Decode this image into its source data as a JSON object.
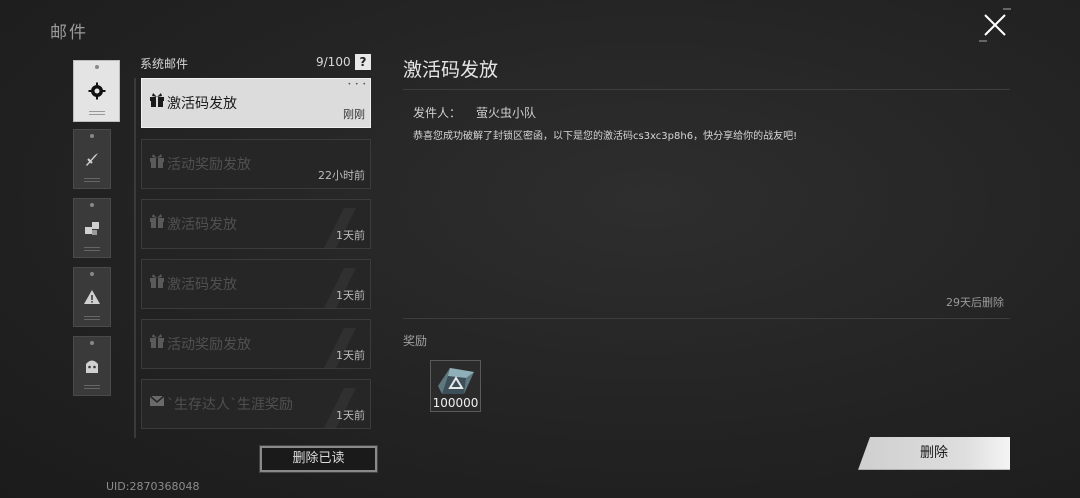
{
  "header": {
    "title": "邮件"
  },
  "categories": [
    {
      "name": "system",
      "icon": "gear-icon"
    },
    {
      "name": "activity",
      "icon": "sword-icon"
    },
    {
      "name": "blocks",
      "icon": "cubes-icon"
    },
    {
      "name": "warning",
      "icon": "warning-icon"
    },
    {
      "name": "character",
      "icon": "face-icon"
    }
  ],
  "list": {
    "header_label": "系统邮件",
    "count": "9/100",
    "help_label": "?",
    "items": [
      {
        "title": "激活码发放",
        "time": "刚刚",
        "icon": "gift-icon"
      },
      {
        "title": "活动奖励发放",
        "time": "22小时前",
        "icon": "gift-icon"
      },
      {
        "title": "激活码发放",
        "time": "1天前",
        "icon": "gift-icon"
      },
      {
        "title": "激活码发放",
        "time": "1天前",
        "icon": "gift-icon"
      },
      {
        "title": "活动奖励发放",
        "time": "1天前",
        "icon": "gift-icon"
      },
      {
        "title": "`生存达人`生涯奖励",
        "time": "1天前",
        "icon": "envelope-icon"
      }
    ],
    "delete_read_label": "删除已读"
  },
  "uid": "UID:2870368048",
  "detail": {
    "title": "激活码发放",
    "sender_label": "发件人：",
    "sender_name": "萤火虫小队",
    "body": "恭喜您成功破解了封锁区密函，以下是您的激活码cs3xc3p8h6，快分享给你的战友吧!",
    "expire": "29天后删除",
    "reward_label": "奖励",
    "rewards": [
      {
        "icon": "crystal-icon",
        "amount": "100000"
      }
    ],
    "delete_label": "删除"
  }
}
